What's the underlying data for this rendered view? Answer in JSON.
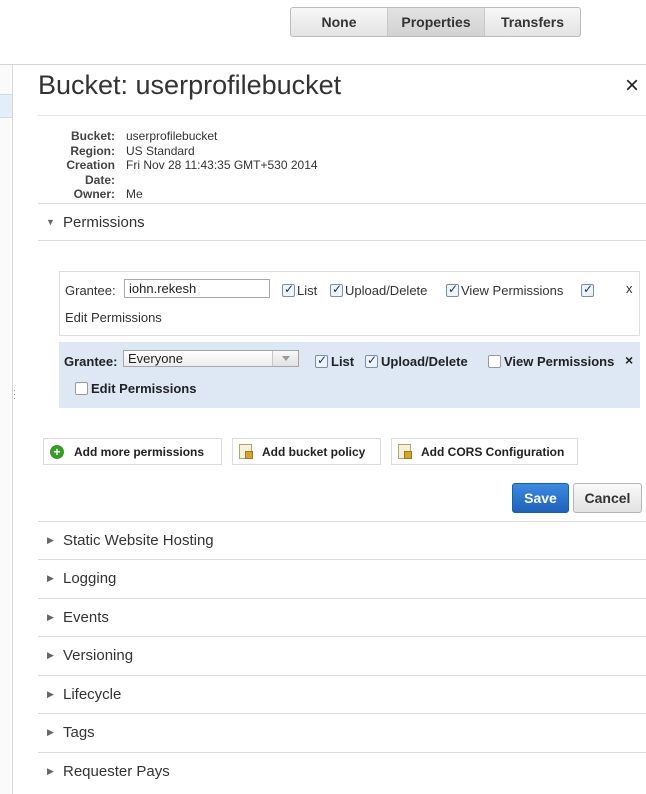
{
  "tabs": {
    "none": "None",
    "properties": "Properties",
    "transfers": "Transfers"
  },
  "panel": {
    "title": "Bucket: userprofilebucket",
    "close": "×"
  },
  "info": [
    {
      "key": "Bucket:",
      "value": "userprofilebucket"
    },
    {
      "key": "Region:",
      "value": "US Standard"
    },
    {
      "key": "Creation Date:",
      "value": "Fri Nov 28 11:43:35 GMT+530 2014"
    },
    {
      "key": "Owner:",
      "value": "Me"
    }
  ],
  "permissions": {
    "header": "Permissions",
    "grant1": {
      "grantee_label": "Grantee:",
      "grantee_value": "iohn.rekesh",
      "list": "List",
      "list_checked": true,
      "upload_delete": "Upload/Delete",
      "upload_delete_checked": true,
      "view_permissions": "View Permissions",
      "view_permissions_checked": true,
      "edit_checked": true,
      "edit_permissions": "Edit Permissions",
      "remove": "x"
    },
    "grant2": {
      "grantee_label": "Grantee:",
      "grantee_value": "Everyone",
      "list": "List",
      "list_checked": true,
      "upload_delete": "Upload/Delete",
      "upload_delete_checked": true,
      "view_permissions": "View Permissions",
      "view_permissions_checked": false,
      "remove": "×",
      "edit_permissions": "Edit Permissions",
      "edit_checked": false
    },
    "add_more": "Add more permissions",
    "add_bucket_policy": "Add bucket policy",
    "add_cors": "Add CORS Configuration",
    "save": "Save",
    "cancel": "Cancel"
  },
  "sections": [
    "Static Website Hosting",
    "Logging",
    "Events",
    "Versioning",
    "Lifecycle",
    "Tags",
    "Requester Pays"
  ],
  "colors": {
    "primary_button": "#2a74cc",
    "selected_grant_bg": "#dde8f4",
    "add_icon": "#3a9a2c"
  }
}
